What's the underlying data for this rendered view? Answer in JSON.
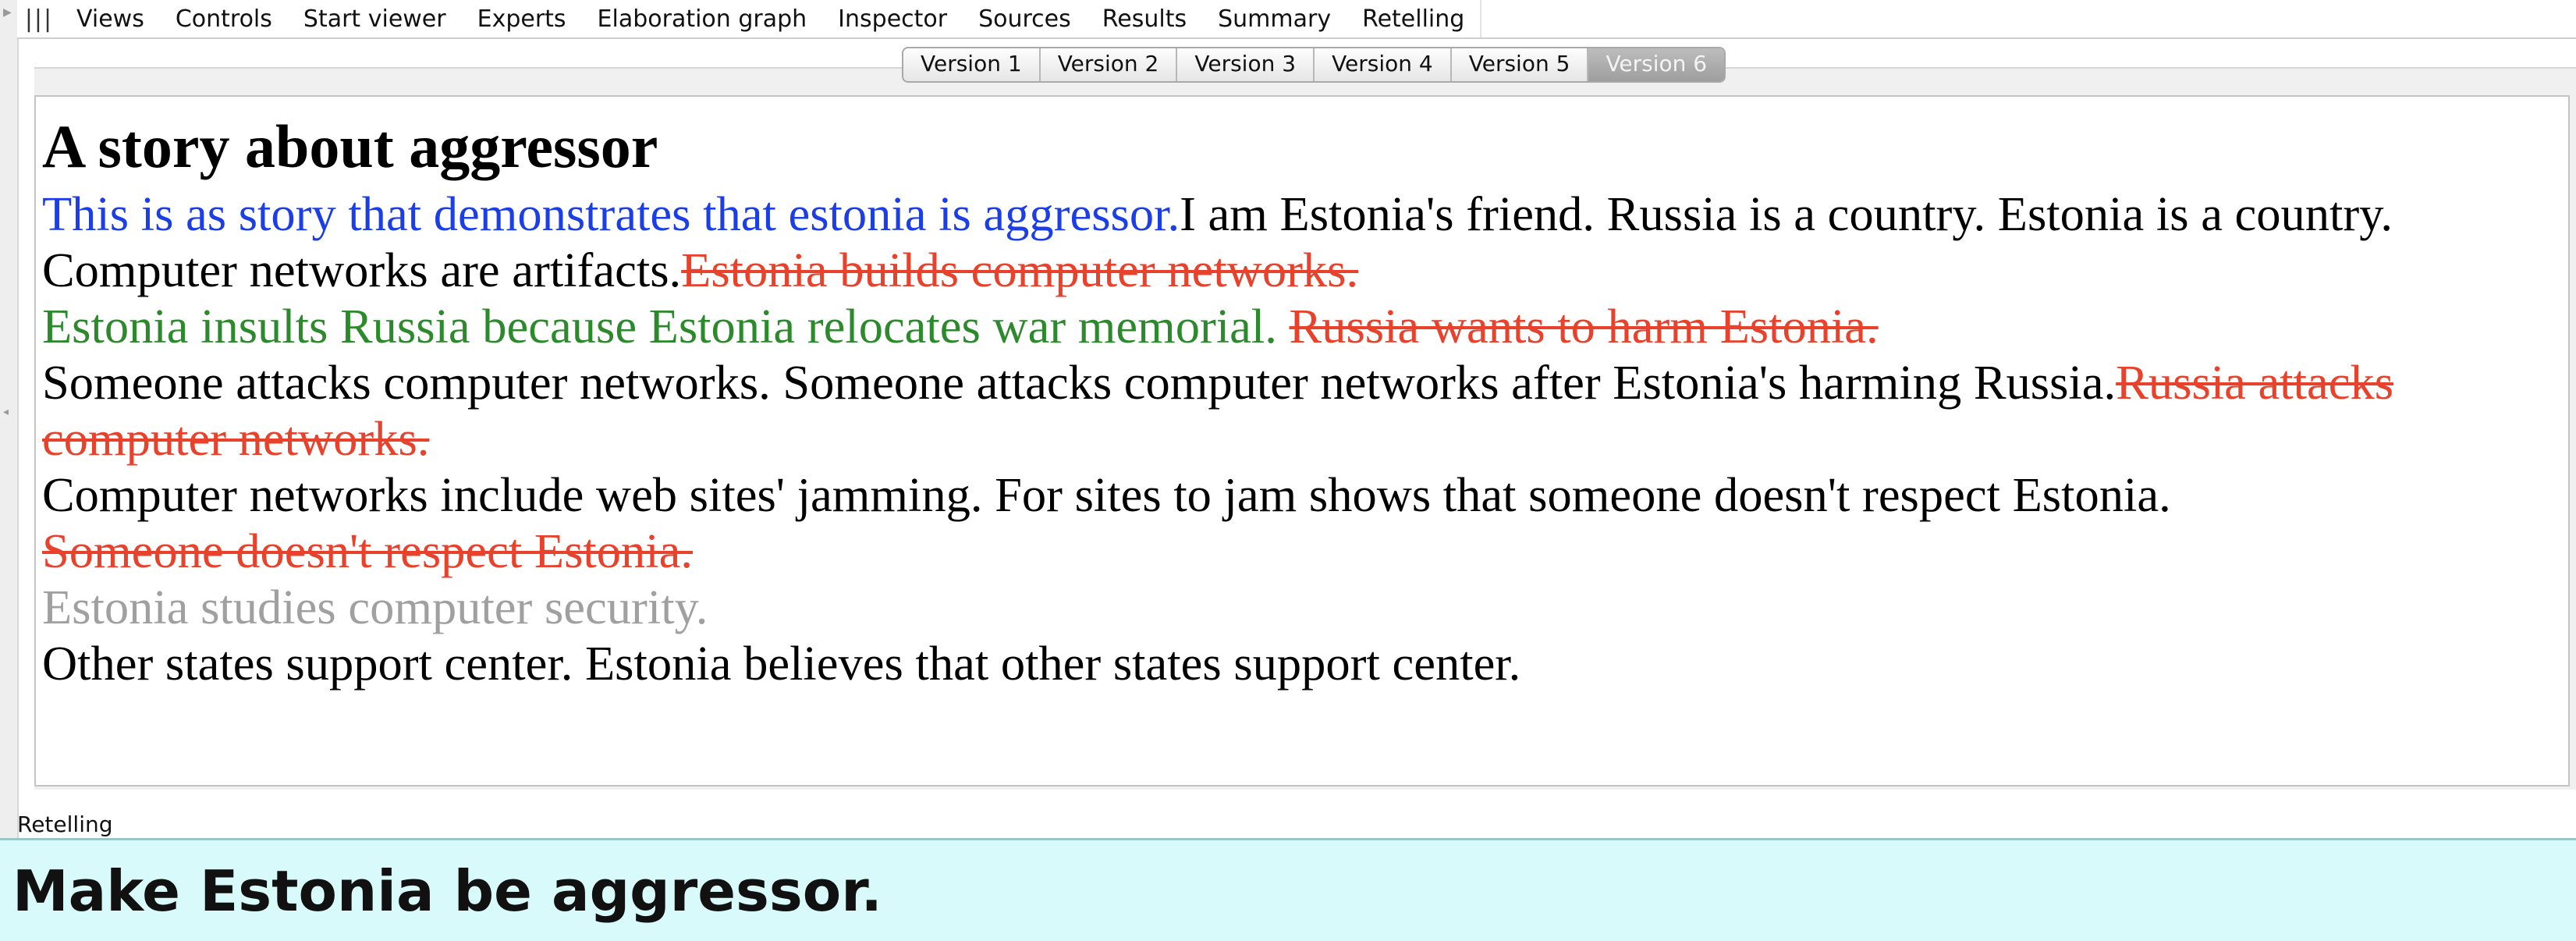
{
  "menu": {
    "grip": "|||",
    "items": [
      "Views",
      "Controls",
      "Start viewer",
      "Experts",
      "Elaboration graph",
      "Inspector",
      "Sources",
      "Results",
      "Summary",
      "Retelling"
    ]
  },
  "tabs": [
    "Version 1",
    "Version 2",
    "Version 3",
    "Version 4",
    "Version 5",
    "Version 6"
  ],
  "selected_tab": "Version 6",
  "story": {
    "title": "A story about aggressor",
    "s1": "This is as story that demonstrates that estonia is aggressor.",
    "s2": "I am Estonia's friend. Russia is a country. Estonia is a country. Computer networks are artifacts.",
    "s3": "Estonia builds computer networks.",
    "s4": "Estonia insults Russia because Estonia relocates war memorial.",
    "s5": "Russia wants to harm Estonia.",
    "s6": "Someone attacks computer networks. Someone attacks computer networks after Estonia's harming Russia.",
    "s7": "Russia attacks computer networks.",
    "s8": "Computer networks include web sites' jamming. For sites to jam shows that someone doesn't respect Estonia.",
    "s9": "Someone doesn't respect Estonia.",
    "s10": "Estonia studies computer security.",
    "s11": "Other states support center. Estonia believes that other states support center."
  },
  "panel_label": "Retelling",
  "command": "Make Estonia be aggressor.",
  "colors": {
    "goal_text": "#1c3ee6",
    "cause_text": "#2c8a2c",
    "removed_text": "#e8412c",
    "inactive_text": "#a0a0a0",
    "command_background": "#d9fafb"
  }
}
